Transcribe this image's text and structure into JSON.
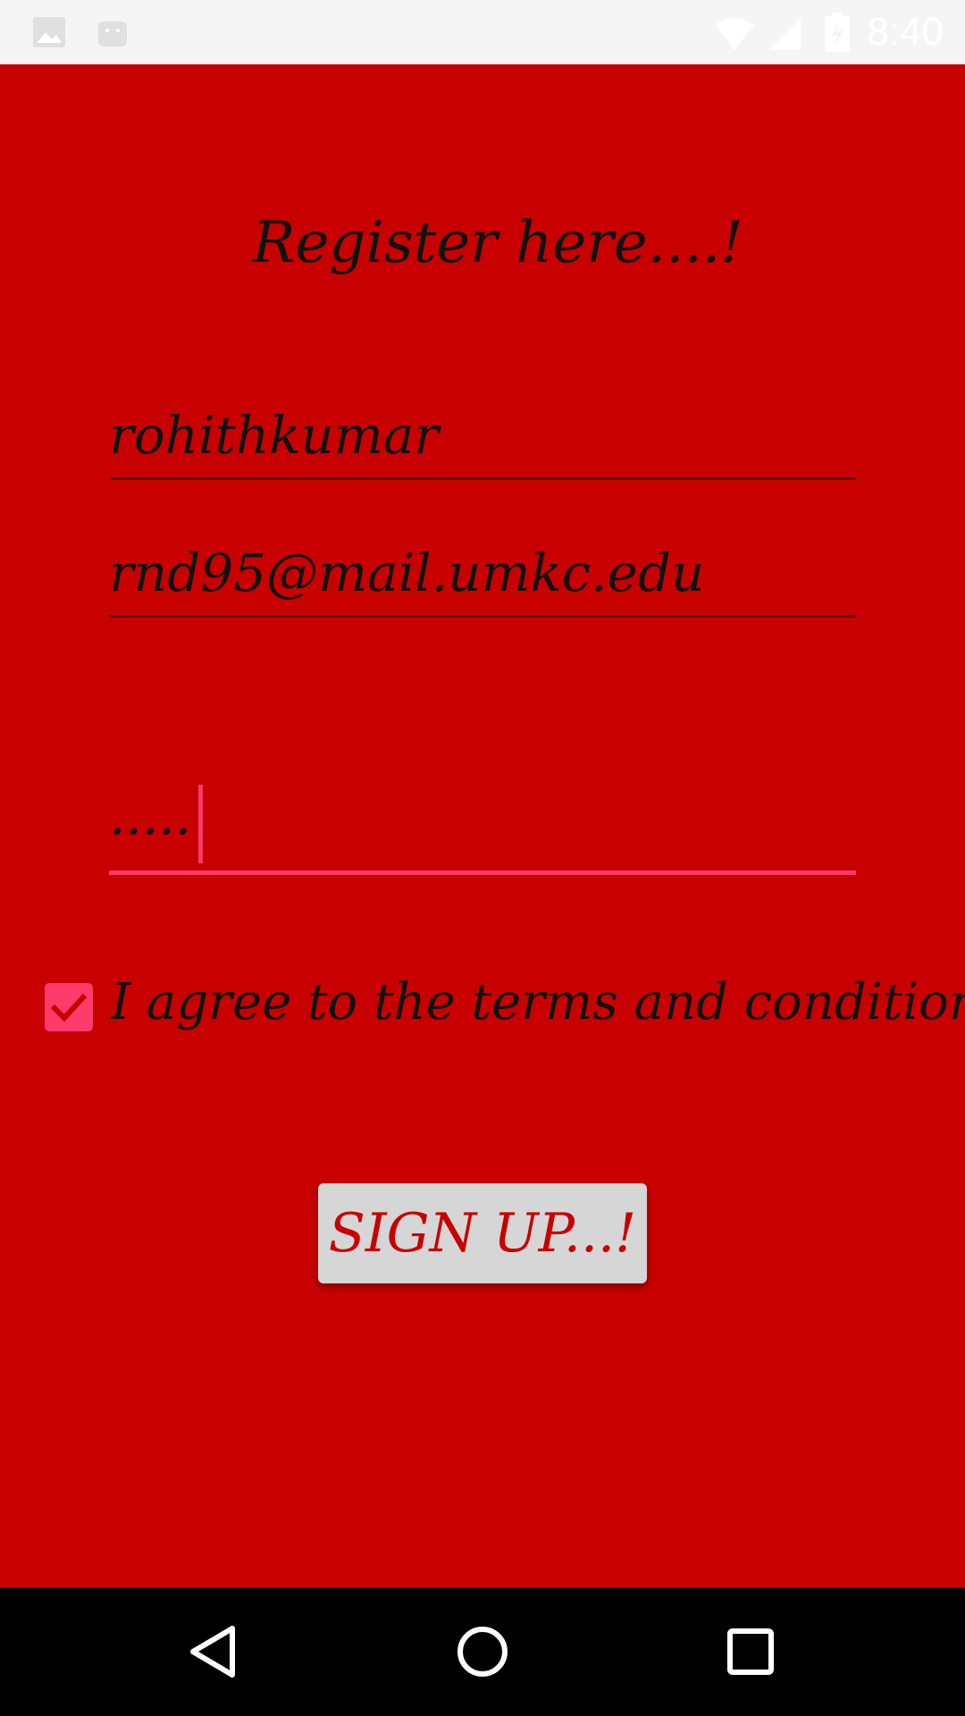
{
  "status_bar": {
    "time": "8:40",
    "icons": [
      "image-icon",
      "android-icon",
      "wifi-icon",
      "signal-icon",
      "battery-icon"
    ]
  },
  "form": {
    "title": "Register here....!",
    "username_value": "rohithkumar",
    "email_value": "rnd95@mail.umkc.edu",
    "password_value": ".....",
    "terms_checked": true,
    "terms_label": "I agree to the terms and conditions",
    "signup_label": "SIGN UP...!"
  },
  "nav_bar": {
    "buttons": [
      "back-icon",
      "home-icon",
      "recents-icon"
    ]
  },
  "colors": {
    "background": "#c80000",
    "accent": "#ff3b6b",
    "button_bg": "#d6d6d6",
    "text": "#111111"
  }
}
